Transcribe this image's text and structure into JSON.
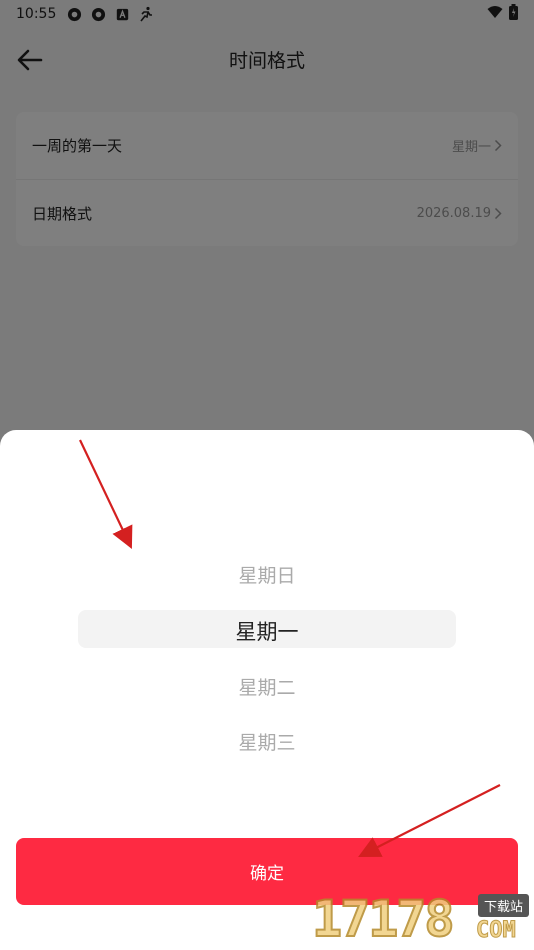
{
  "status_bar": {
    "time": "10:55",
    "left_icons": [
      "aperture-icon",
      "aperture-icon",
      "a-square-icon",
      "running-icon"
    ],
    "right_icons": [
      "wifi-icon",
      "battery-icon"
    ]
  },
  "header": {
    "title": "时间格式"
  },
  "settings": [
    {
      "label": "一周的第一天",
      "value": "星期一"
    },
    {
      "label": "日期格式",
      "value": "2026.08.19"
    }
  ],
  "picker": {
    "options": [
      "星期日",
      "星期一",
      "星期二",
      "星期三"
    ],
    "selected_index": 1
  },
  "confirm_button": {
    "label": "确定"
  },
  "colors": {
    "accent": "#fe2a42",
    "annotation_arrow": "#d42020",
    "overlay": "rgba(0,0,0,0.5)"
  },
  "watermark": {
    "number": "17178",
    "badge": "下载站",
    "suffix": "COM"
  }
}
